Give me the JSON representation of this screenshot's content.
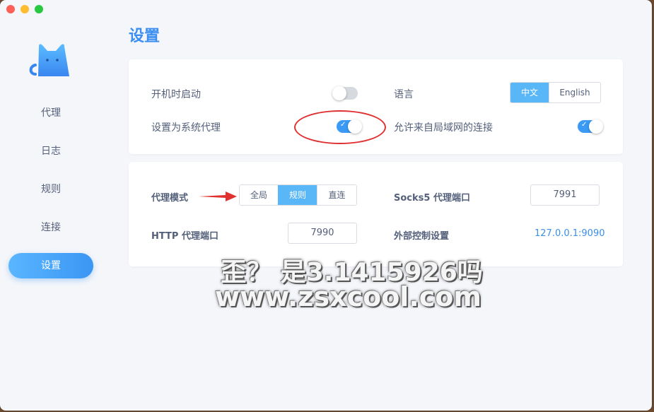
{
  "window": {
    "controls": [
      "close",
      "minimize",
      "zoom"
    ]
  },
  "sidebar": {
    "logo_icon": "cat-icon",
    "items": [
      {
        "label": "代理"
      },
      {
        "label": "日志"
      },
      {
        "label": "规则"
      },
      {
        "label": "连接"
      },
      {
        "label": "设置",
        "active": true
      }
    ]
  },
  "page": {
    "title": "设置"
  },
  "general": {
    "launch_at_login": {
      "label": "开机时启动",
      "enabled": false
    },
    "system_proxy": {
      "label": "设置为系统代理",
      "enabled": true
    },
    "language": {
      "label": "语言",
      "options": [
        "中文",
        "English"
      ],
      "selected": "中文"
    },
    "allow_lan": {
      "label": "允许来自局域网的连接",
      "enabled": true
    }
  },
  "proxy": {
    "mode": {
      "label": "代理模式",
      "options": [
        "全局",
        "规则",
        "直连"
      ],
      "selected": "规则"
    },
    "socks5_port": {
      "label": "Socks5 代理端口",
      "value": "7991"
    },
    "http_port": {
      "label": "HTTP 代理端口",
      "value": "7990"
    },
    "external_controller": {
      "label": "外部控制设置",
      "value": "127.0.0.1:9090"
    }
  },
  "watermark": {
    "line1": "歪？ 是3.1415926吗",
    "line2": "www.zsxcool.com"
  },
  "colors": {
    "accent": "#3a9af5",
    "annotation": "#e03030"
  }
}
